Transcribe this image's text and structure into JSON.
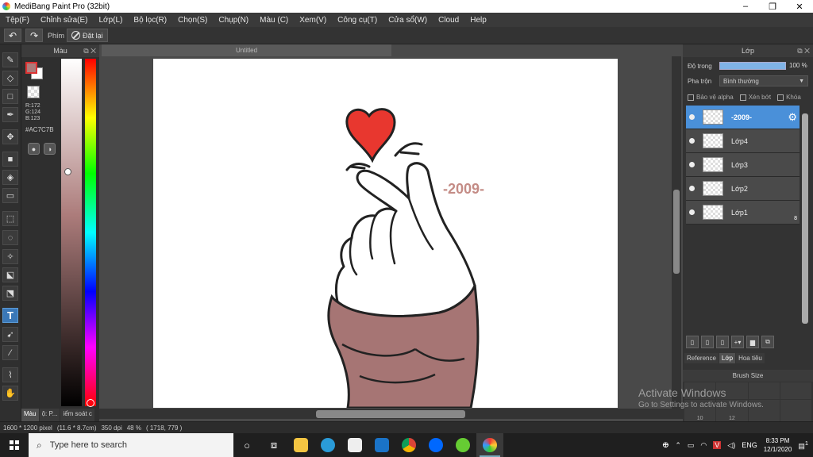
{
  "window": {
    "title": "MediBang Paint Pro (32bit)",
    "controls": [
      "–",
      "❐",
      "✕"
    ]
  },
  "menu": [
    "Tệp(F)",
    "Chỉnh sửa(E)",
    "Lớp(L)",
    "Bộ lọc(R)",
    "Chọn(S)",
    "Chụp(N)",
    "Màu (C)",
    "Xem(V)",
    "Công cụ(T)",
    "Cửa sổ(W)",
    "Cloud",
    "Help"
  ],
  "toolbar": {
    "undo": "↶",
    "redo": "↷",
    "phim_label": "Phím",
    "reset_label": "Đặt lại"
  },
  "color_panel": {
    "title": "Màu",
    "r": "R:172",
    "g": "G:124",
    "b": "B:123",
    "hex": "#AC7C7B",
    "fg_color": "#ac7c7b",
    "tabs": [
      "Màu",
      "ộ: P...",
      "iểm soát c"
    ]
  },
  "document": {
    "tab_title": "Untitled",
    "artwork_text": "-2009-"
  },
  "layer_panel": {
    "title": "Lớp",
    "opacity_label": "Độ trong",
    "opacity_value": "100 %",
    "blend_label": "Pha trộn",
    "blend_value": "Bình thường",
    "protect_alpha": "Bảo vệ alpha",
    "clipping": "Xén bớt",
    "lock": "Khóa",
    "layers": [
      {
        "name": "-2009-",
        "selected": true
      },
      {
        "name": "Lớp4",
        "selected": false
      },
      {
        "name": "Lớp3",
        "selected": false
      },
      {
        "name": "Lớp2",
        "selected": false
      },
      {
        "name": "Lớp1",
        "selected": false,
        "bits": "8"
      }
    ],
    "tabs": [
      "Reference",
      "Lớp",
      "Hoa tiêu"
    ]
  },
  "brush_panel": {
    "title": "Brush Size",
    "sizes": [
      "",
      "",
      "",
      "",
      "10",
      "12",
      "",
      "",
      "",
      "",
      "",
      ""
    ]
  },
  "watermark": {
    "line1": "Activate Windows",
    "line2": "Go to Settings to activate Windows."
  },
  "status": {
    "size": "1600 * 1200 pixel",
    "cm": "(11.6 * 8.7cm)",
    "dpi": "350 dpi",
    "zoom": "48 %",
    "coords": "( 1718, 779 )"
  },
  "taskbar": {
    "search_placeholder": "Type here to search",
    "lang": "ENG",
    "time": "8:33 PM",
    "date": "12/1/2020",
    "notif_count": "1"
  }
}
